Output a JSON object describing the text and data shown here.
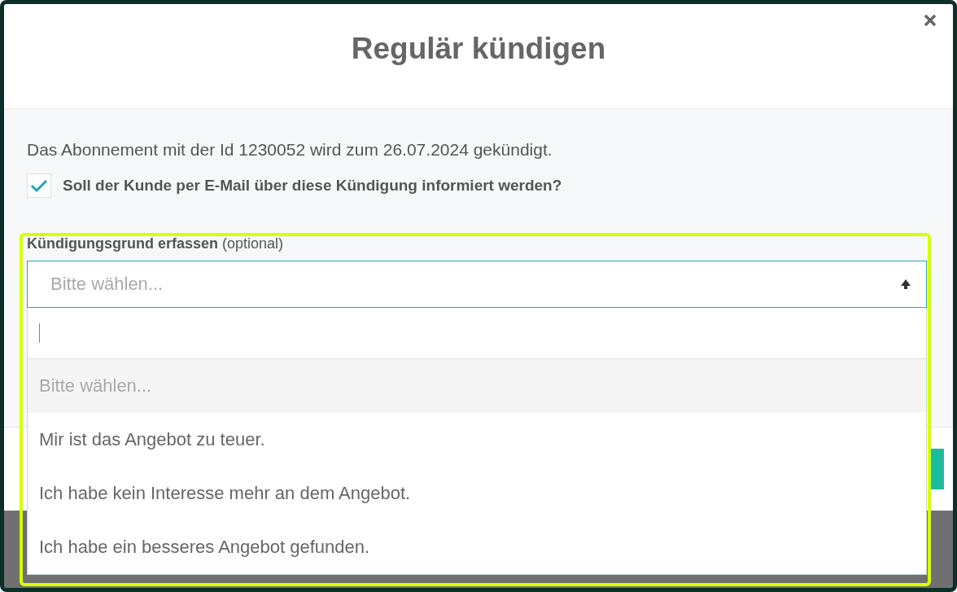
{
  "dialog": {
    "title": "Regulär kündigen",
    "message": "Das Abonnement mit der Id 1230052 wird zum 26.07.2024 gekündigt.",
    "notify_checkbox": {
      "label": "Soll der Kunde per E-Mail über diese Kündigung informiert werden?",
      "checked": true
    },
    "reason_field": {
      "label": "Kündigungsgrund erfassen",
      "hint": "(optional)",
      "placeholder": "Bitte wählen...",
      "expanded": true,
      "options": [
        {
          "kind": "placeholder",
          "label": "Bitte wählen...",
          "selected": true
        },
        {
          "kind": "option",
          "label": "Mir ist das Angebot zu teuer.",
          "selected": false
        },
        {
          "kind": "option",
          "label": "Ich habe kein Interesse mehr an dem Angebot.",
          "selected": false
        },
        {
          "kind": "option",
          "label": "Ich habe ein besseres Angebot gefunden.",
          "selected": false
        }
      ]
    }
  }
}
